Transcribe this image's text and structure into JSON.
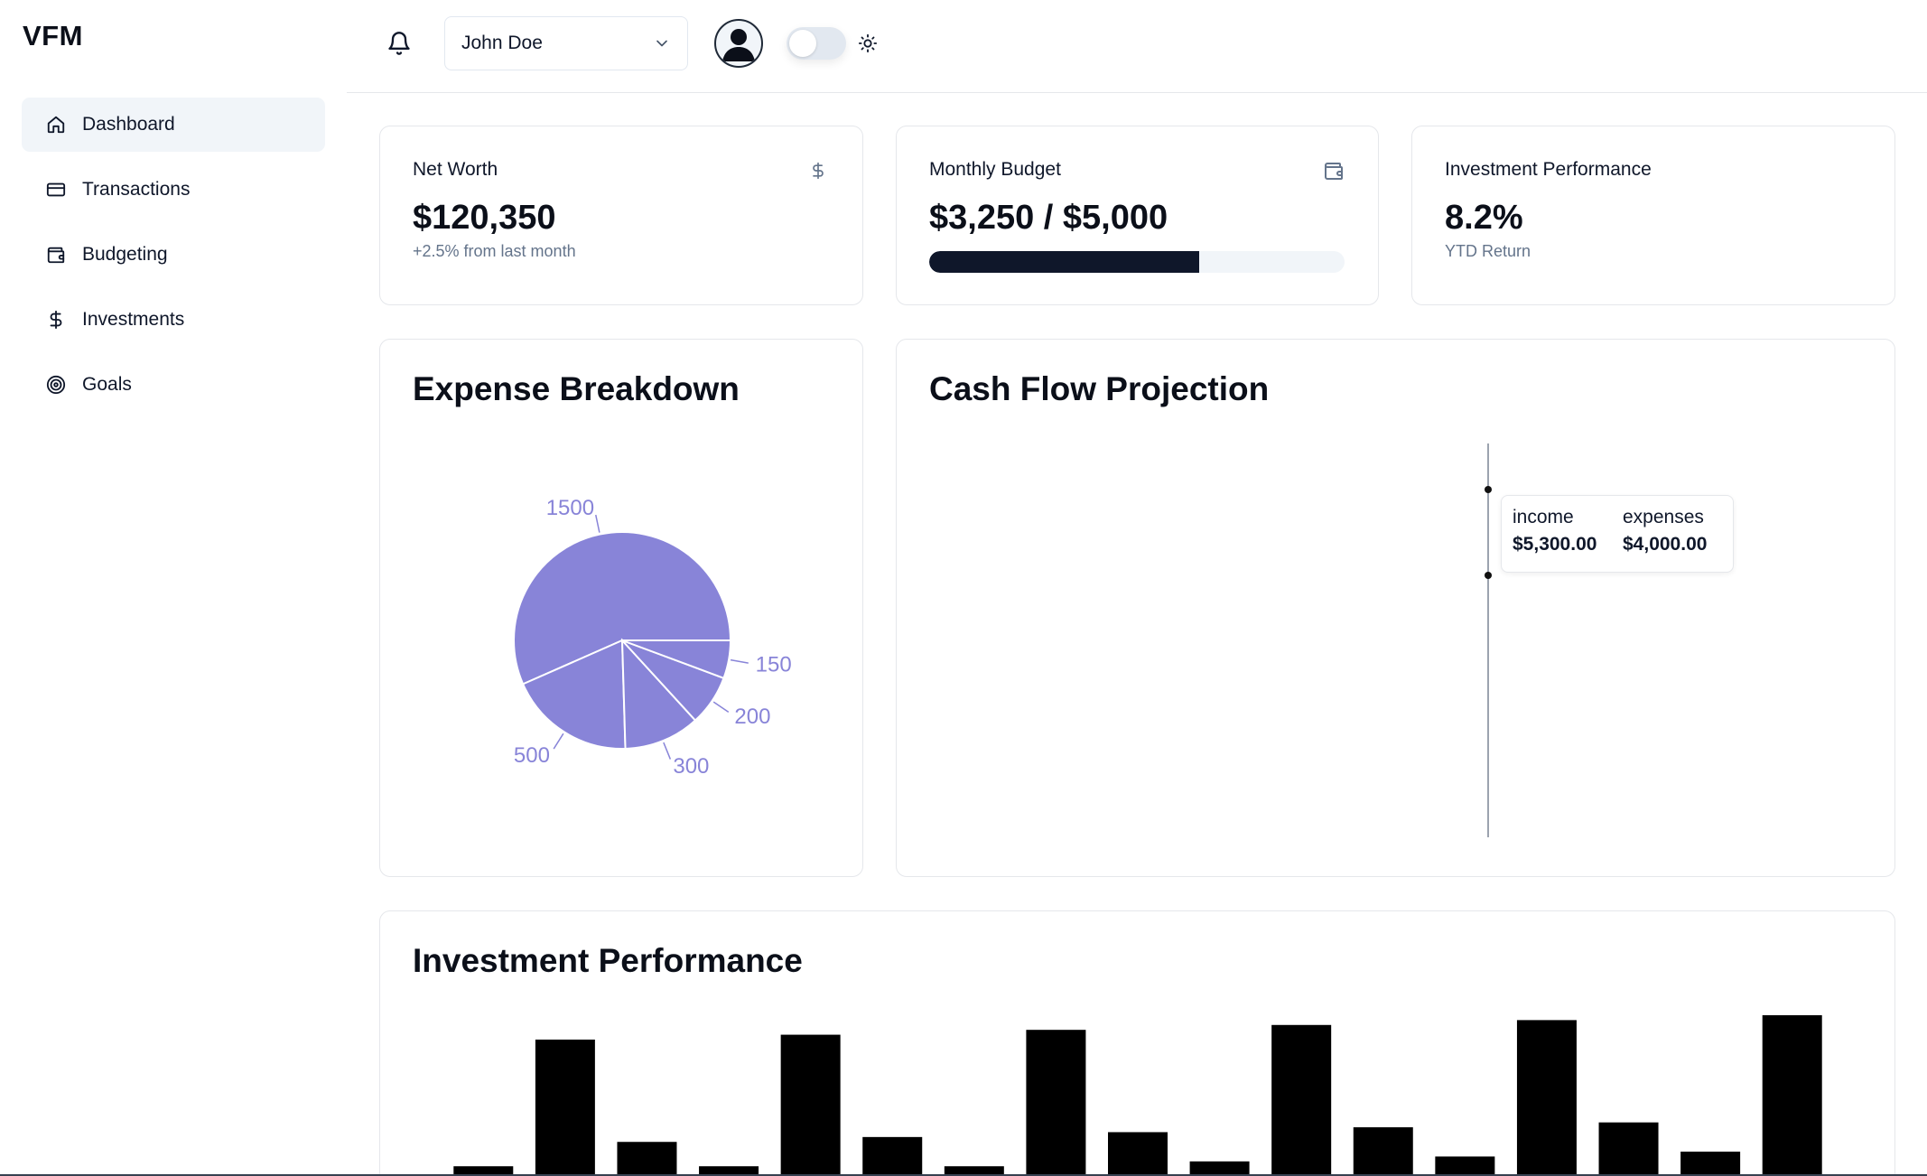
{
  "brand": "VFM",
  "sidebar": {
    "items": [
      {
        "label": "Dashboard",
        "icon": "home-icon",
        "active": true
      },
      {
        "label": "Transactions",
        "icon": "credit-card-icon",
        "active": false
      },
      {
        "label": "Budgeting",
        "icon": "wallet-icon",
        "active": false
      },
      {
        "label": "Investments",
        "icon": "dollar-icon",
        "active": false
      },
      {
        "label": "Goals",
        "icon": "target-icon",
        "active": false
      }
    ]
  },
  "header": {
    "user_name": "John Doe",
    "theme_toggle_on": false
  },
  "stats": {
    "net_worth": {
      "title": "Net Worth",
      "value": "$120,350",
      "sub": "+2.5% from last month",
      "icon": "dollar-icon"
    },
    "monthly_budget": {
      "title": "Monthly Budget",
      "value": "$3,250 / $5,000",
      "progress": 0.65,
      "icon": "wallet-icon"
    },
    "investment_performance": {
      "title": "Investment Performance",
      "value": "8.2%",
      "sub": "YTD Return"
    }
  },
  "expense_card": {
    "title": "Expense Breakdown"
  },
  "cashflow_card": {
    "title": "Cash Flow Projection",
    "tooltip": {
      "income_label": "income",
      "income_value": "$5,300.00",
      "expenses_label": "expenses",
      "expenses_value": "$4,000.00"
    }
  },
  "investment_card": {
    "title": "Investment Performance"
  },
  "chart_data": [
    {
      "type": "pie",
      "values": [
        1500,
        500,
        300,
        200,
        150
      ],
      "color": "#8884d8"
    },
    {
      "type": "line",
      "series": [
        {
          "name": "income",
          "hover_value": 5300
        },
        {
          "name": "expenses",
          "hover_value": 4000
        }
      ]
    },
    {
      "type": "bar",
      "values": [
        2,
        28,
        7,
        2,
        29,
        8,
        2,
        30,
        9,
        3,
        31,
        10,
        4,
        32,
        11,
        5,
        33
      ],
      "color": "#000000"
    }
  ]
}
